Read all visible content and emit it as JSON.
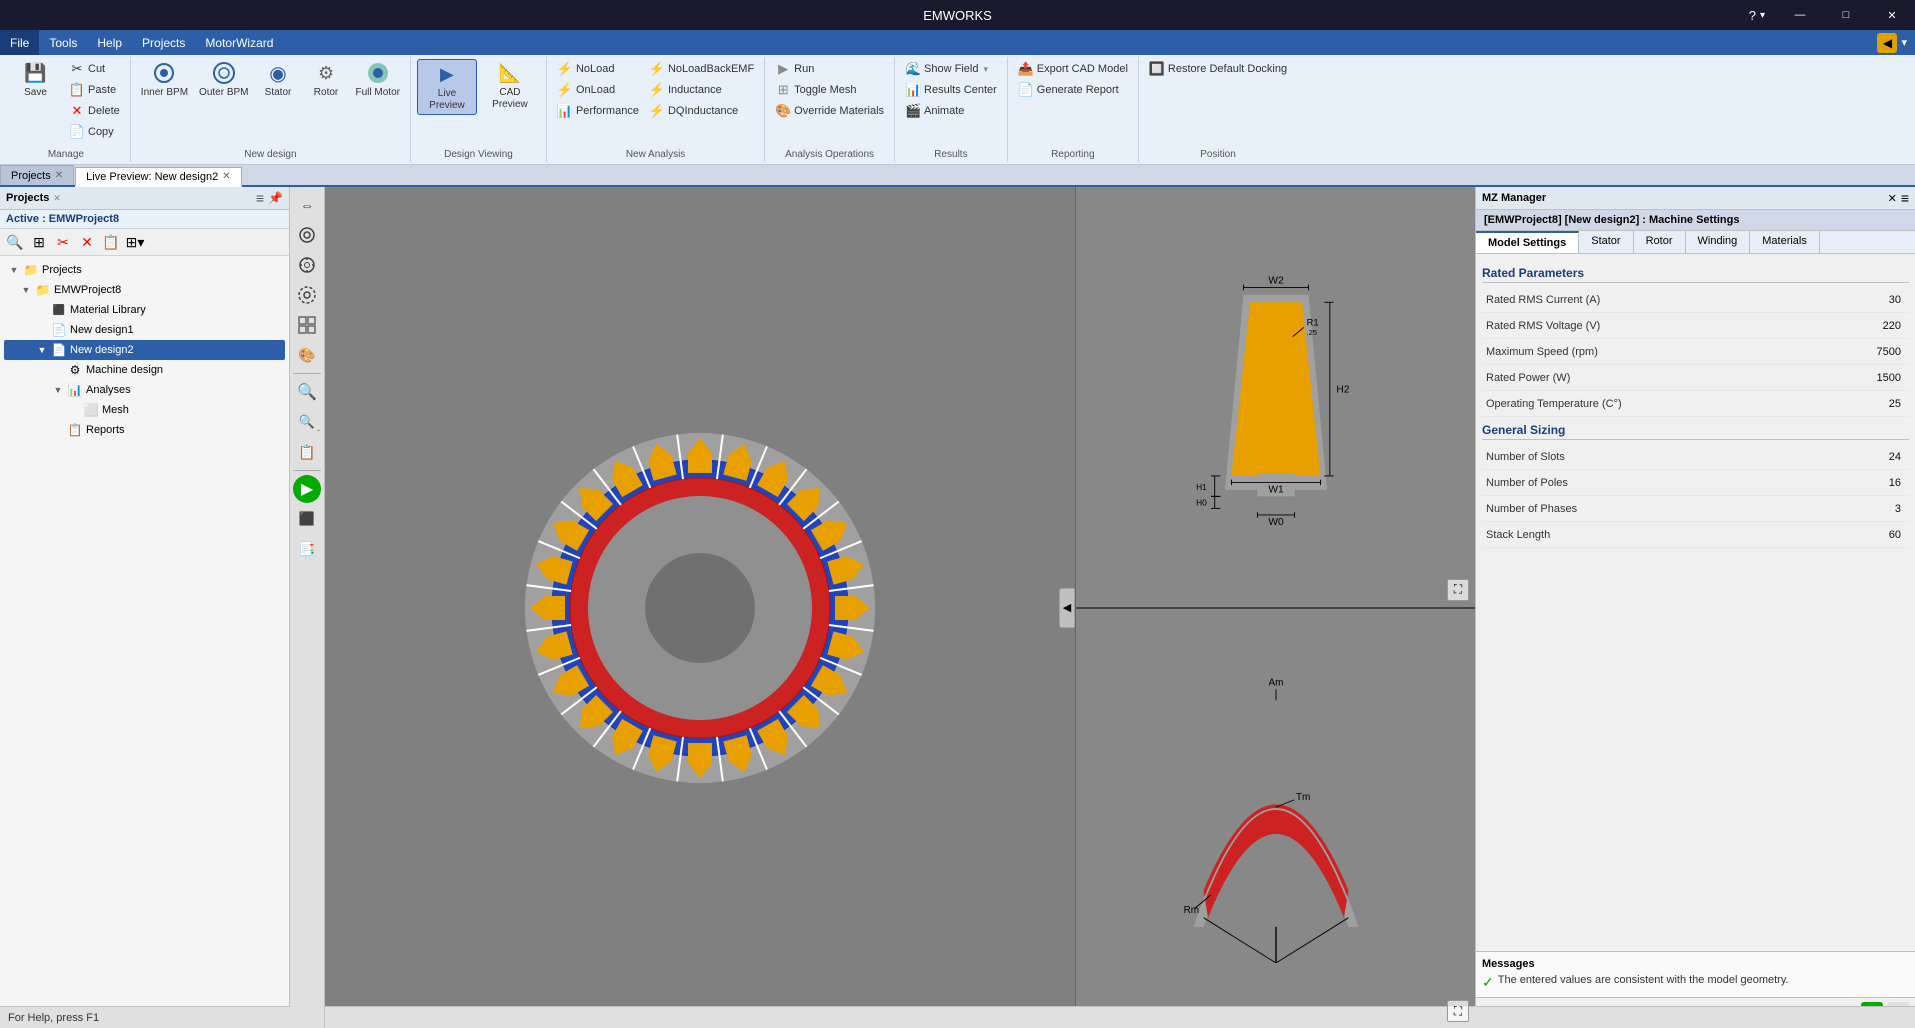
{
  "titleBar": {
    "title": "EMWORKS",
    "helpBtn": "?",
    "winBtns": [
      "—",
      "□",
      "✕"
    ]
  },
  "menuBar": {
    "items": [
      "File",
      "Tools",
      "Help",
      "Projects",
      "MotorWizard"
    ]
  },
  "ribbon": {
    "groups": [
      {
        "label": "Manage",
        "buttons": [
          {
            "id": "save",
            "icon": "💾",
            "label": "Save"
          },
          {
            "id": "delete",
            "icon": "✕",
            "label": "Delete",
            "color": "red"
          },
          {
            "id": "copy",
            "icon": "📋",
            "label": "Copy"
          },
          {
            "id": "cut",
            "icon": "✂",
            "label": "Cut"
          },
          {
            "id": "paste",
            "icon": "📌",
            "label": "Paste"
          }
        ]
      },
      {
        "label": "New design",
        "buttons": [
          {
            "id": "innerbpm",
            "icon": "⭕",
            "label": "Inner BPM"
          },
          {
            "id": "outerbpm",
            "icon": "⭕",
            "label": "Outer BPM"
          },
          {
            "id": "stator",
            "icon": "🔵",
            "label": "Stator"
          },
          {
            "id": "rotor",
            "icon": "⚙",
            "label": "Rotor"
          },
          {
            "id": "fullmotor",
            "icon": "🔄",
            "label": "Full Motor"
          }
        ]
      },
      {
        "label": "Design Viewing",
        "buttons": [
          {
            "id": "livepreview",
            "icon": "▶",
            "label": "Live Preview",
            "active": true
          },
          {
            "id": "cadpreview",
            "icon": "📐",
            "label": "CAD Preview"
          }
        ]
      },
      {
        "label": "New Analysis",
        "buttons": [
          {
            "id": "noload",
            "icon": "⚡",
            "label": "NoLoad"
          },
          {
            "id": "onload",
            "icon": "⚡",
            "label": "OnLoad"
          },
          {
            "id": "performance",
            "icon": "📊",
            "label": "Performance"
          },
          {
            "id": "noloadbackemf",
            "icon": "⚡",
            "label": "NoLoadBackEMF"
          },
          {
            "id": "inductance",
            "icon": "⚡",
            "label": "Inductance"
          },
          {
            "id": "dqinductance",
            "icon": "⚡",
            "label": "DQInductance"
          }
        ]
      },
      {
        "label": "Analysis Operations",
        "buttons": [
          {
            "id": "run",
            "icon": "▶",
            "label": "Run"
          },
          {
            "id": "togglemesh",
            "icon": "🔲",
            "label": "Toggle Mesh"
          },
          {
            "id": "overridematerials",
            "icon": "🎨",
            "label": "Override Materials"
          }
        ]
      },
      {
        "label": "Results",
        "buttons": [
          {
            "id": "showfield",
            "icon": "🌊",
            "label": "Show Field"
          },
          {
            "id": "resultscenter",
            "icon": "📊",
            "label": "Results Center"
          },
          {
            "id": "animate",
            "icon": "🎬",
            "label": "Animate"
          }
        ]
      },
      {
        "label": "Reporting",
        "buttons": [
          {
            "id": "exportcad",
            "icon": "📤",
            "label": "Export CAD Model"
          },
          {
            "id": "generatereport",
            "icon": "📄",
            "label": "Generate Report"
          }
        ]
      },
      {
        "label": "Position",
        "buttons": [
          {
            "id": "restoredocking",
            "icon": "🔲",
            "label": "Restore Default Docking"
          }
        ]
      }
    ]
  },
  "tabs": [
    {
      "label": "Projects",
      "closable": false,
      "active": false
    },
    {
      "label": "Live Preview: New design2",
      "closable": true,
      "active": true
    }
  ],
  "sidebar": {
    "title": "Projects",
    "activeProject": "Active : EMWProject8",
    "tree": [
      {
        "level": 0,
        "icon": "📁",
        "label": "Projects",
        "expanded": true
      },
      {
        "level": 1,
        "icon": "📁",
        "label": "EMWProject8",
        "expanded": true
      },
      {
        "level": 2,
        "icon": "🗂",
        "label": "Material Library"
      },
      {
        "level": 2,
        "icon": "📄",
        "label": "New design1"
      },
      {
        "level": 2,
        "icon": "📄",
        "label": "New design2",
        "selected": true
      },
      {
        "level": 3,
        "icon": "⚙",
        "label": "Machine design"
      },
      {
        "level": 3,
        "icon": "📊",
        "label": "Analyses",
        "expanded": true
      },
      {
        "level": 4,
        "icon": "🔲",
        "label": "Mesh"
      },
      {
        "level": 3,
        "icon": "📋",
        "label": "Reports"
      }
    ]
  },
  "mzManager": {
    "title": "MZ Manager",
    "machineTitle": "[EMWProject8] [New design2] : Machine Settings",
    "tabs": [
      "Model Settings",
      "Stator",
      "Rotor",
      "Winding",
      "Materials"
    ],
    "activeTab": "Model Settings",
    "sections": [
      {
        "title": "Rated Parameters",
        "rows": [
          {
            "label": "Rated RMS Current (A)",
            "value": "30"
          },
          {
            "label": "Rated RMS Voltage (V)",
            "value": "220"
          },
          {
            "label": "Maximum Speed (rpm)",
            "value": "7500"
          },
          {
            "label": "Rated Power (W)",
            "value": "1500"
          },
          {
            "label": "Operating Temperature (C°)",
            "value": "25"
          }
        ]
      },
      {
        "title": "General Sizing",
        "rows": [
          {
            "label": "Number of Slots",
            "value": "24"
          },
          {
            "label": "Number of Poles",
            "value": "16"
          },
          {
            "label": "Number of Phases",
            "value": "3"
          },
          {
            "label": "Stack Length",
            "value": "60"
          }
        ]
      }
    ],
    "messages": {
      "title": "Messages",
      "items": [
        {
          "type": "success",
          "text": "The entered values are consistent with the model geometry."
        }
      ]
    }
  },
  "statusBar": {
    "text": "For Help, press F1"
  },
  "leftToolbar": {
    "buttons": [
      {
        "icon": "⇔",
        "tooltip": "measure"
      },
      {
        "icon": "⚙",
        "tooltip": "gear1"
      },
      {
        "icon": "⚙",
        "tooltip": "gear2"
      },
      {
        "icon": "⚙",
        "tooltip": "gear3"
      },
      {
        "icon": "⊞",
        "tooltip": "grid"
      },
      {
        "icon": "🎨",
        "tooltip": "color"
      },
      {
        "icon": "divider"
      },
      {
        "icon": "🔍+",
        "tooltip": "zoom-in"
      },
      {
        "icon": "🔍-",
        "tooltip": "zoom-out"
      },
      {
        "icon": "📋",
        "tooltip": "clipboard"
      },
      {
        "icon": "divider"
      },
      {
        "icon": "▶",
        "tooltip": "play",
        "green": true
      },
      {
        "icon": "⬛",
        "tooltip": "capture"
      },
      {
        "icon": "📑",
        "tooltip": "layers"
      }
    ]
  }
}
